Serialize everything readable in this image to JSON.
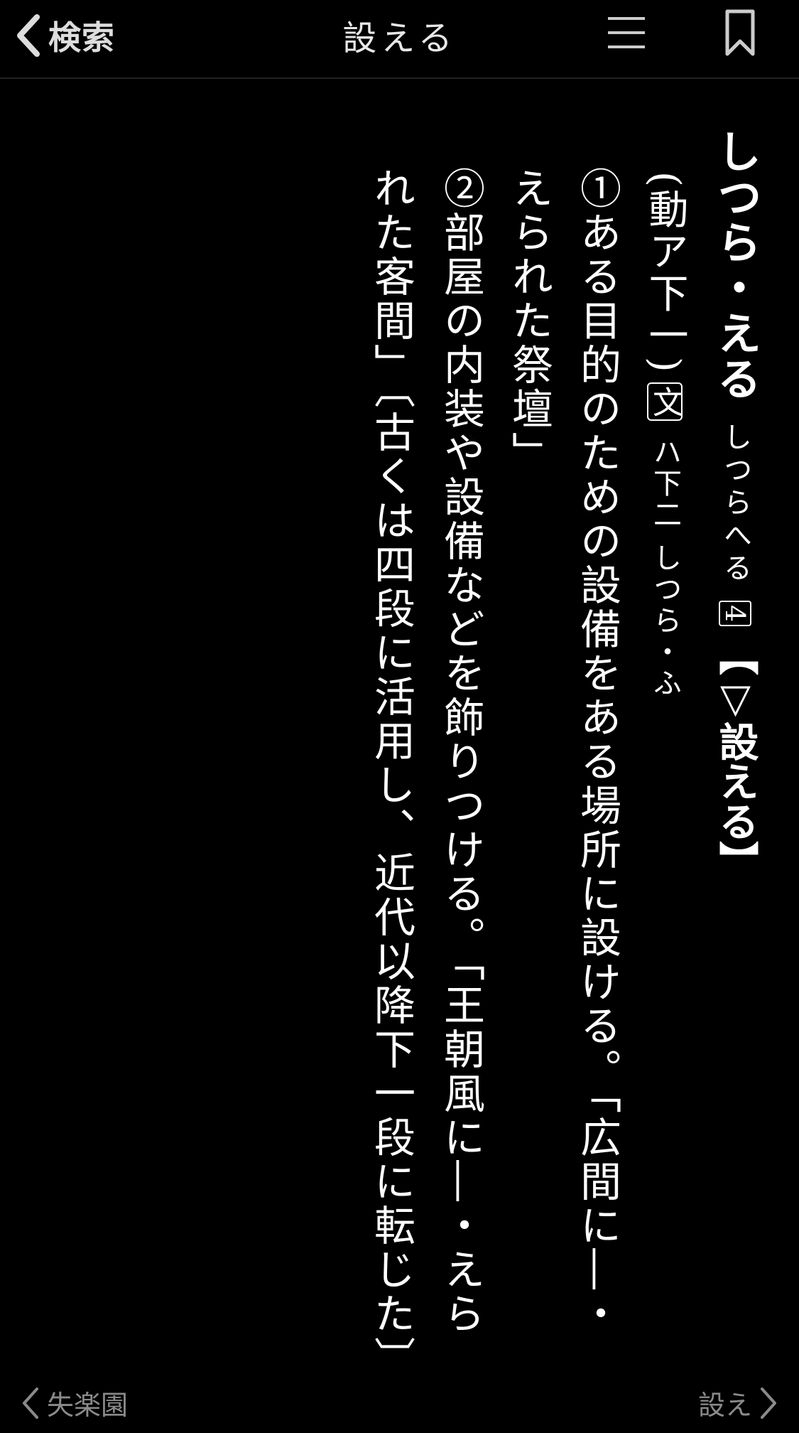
{
  "header": {
    "back_label": "検索",
    "title": "設える"
  },
  "entry": {
    "headword": "しつら・える",
    "reading_variant": "しつらへる",
    "number": "4",
    "kanji_heading": "【▽設える】",
    "pos_line": "(動ア下一)",
    "bun_mark": "文",
    "bun_conjugation": "ハ下二 しつら・ふ",
    "sense1_line1": "①ある目的のための設備をある場所に設ける。「広間に―・",
    "sense1_line2": "えられた祭壇」",
    "sense2_line1": "②部屋の内装や設備などを飾りつける。「王朝風に―・えら",
    "sense2_line2": "れた客間」〔古くは四段に活用し、近代以降下一段に転じた〕"
  },
  "footer": {
    "prev_label": "失楽園",
    "next_label": "設え"
  },
  "colors": {
    "background": "#000000",
    "text": "#ffffff",
    "muted": "#8a8a8a"
  }
}
